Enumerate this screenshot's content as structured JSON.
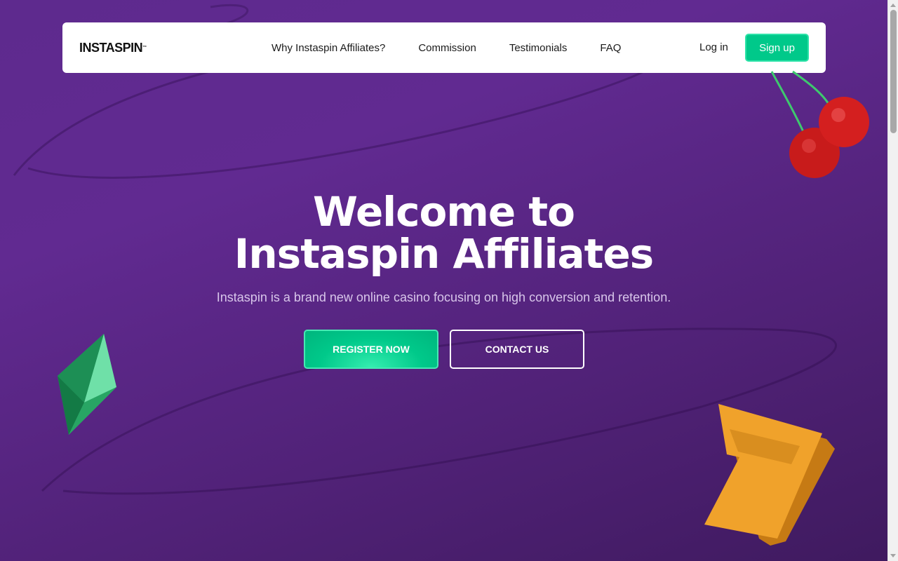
{
  "nav": {
    "logo_text": "INSTASPIN",
    "logo_tm": "™",
    "links": [
      {
        "label": "Why Instaspin Affiliates?"
      },
      {
        "label": "Commission"
      },
      {
        "label": "Testimonials"
      },
      {
        "label": "FAQ"
      }
    ],
    "login_label": "Log in",
    "signup_label": "Sign up"
  },
  "hero": {
    "title_line1": "Welcome to",
    "title_line2": "Instaspin Affiliates",
    "subtitle": "Instaspin is a brand new online casino focusing on high conversion and retention.",
    "register_label": "REGISTER NOW",
    "contact_label": "CONTACT US"
  },
  "decorations": {
    "cherry": "cherry-icon",
    "gem": "gem-icon",
    "seven": "lucky-seven-icon"
  },
  "colors": {
    "background": "#5e2a8e",
    "accent": "#00c98a",
    "navbar": "#ffffff"
  }
}
